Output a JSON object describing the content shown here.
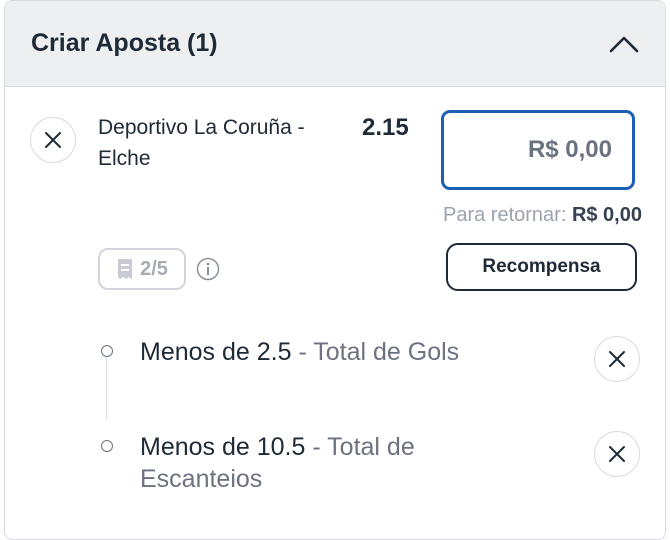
{
  "header": {
    "title": "Criar Aposta (1)"
  },
  "bet": {
    "event": "Deportivo La Coruña - Elche",
    "odds": "2.15",
    "stake_value": "R$ 0,00",
    "return_label": "Para retornar:",
    "return_value": "R$ 0,00",
    "legs_count": "2/5",
    "reward_label": "Recompensa"
  },
  "legs": [
    {
      "selection": "Menos de 2.5",
      "separator": " - ",
      "market": "Total de Gols"
    },
    {
      "selection": "Menos de 10.5",
      "separator": " - ",
      "market": "Total de Escanteios"
    }
  ],
  "colors": {
    "accent": "#1a5fb4",
    "text": "#1f2a37",
    "muted": "#6b7280",
    "header_bg": "#eeeff1"
  }
}
